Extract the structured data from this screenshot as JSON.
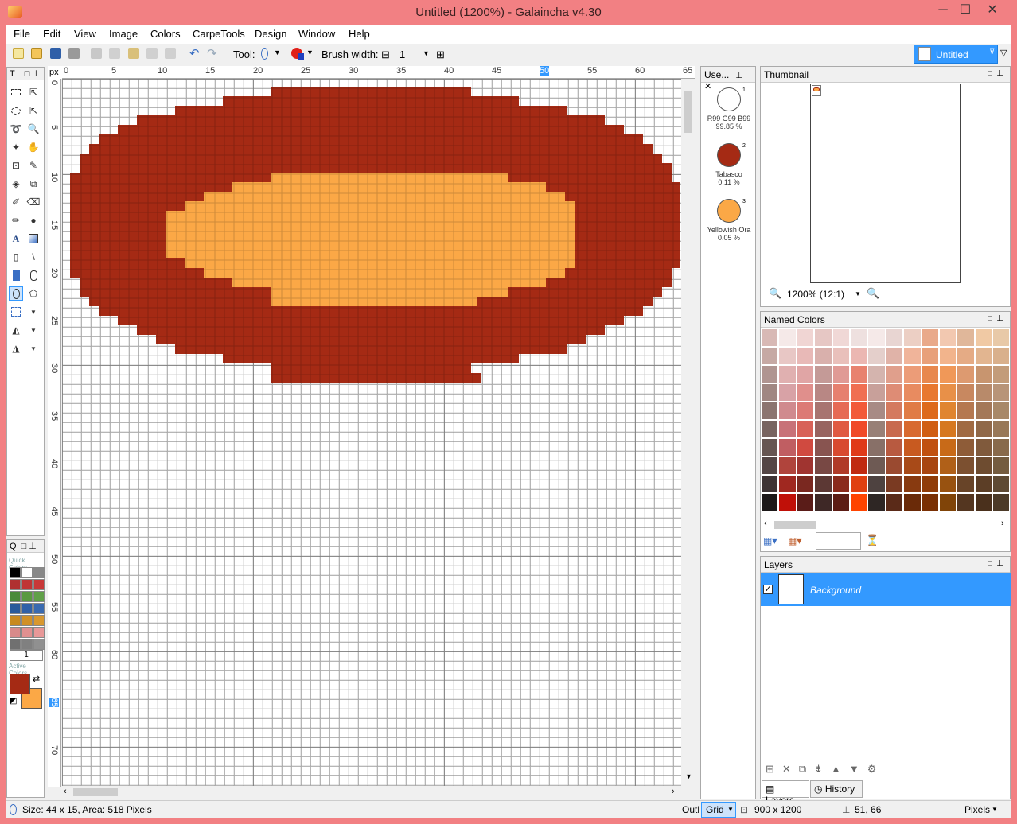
{
  "window": {
    "title": "Untitled (1200%) - Galaincha v4.30",
    "minimize": "─",
    "maximize": "☐",
    "close": "✕"
  },
  "menu": [
    "File",
    "Edit",
    "View",
    "Image",
    "Colors",
    "CarpeTools",
    "Design",
    "Window",
    "Help"
  ],
  "toolbar": {
    "tool_label": "Tool:",
    "brush_label": "Brush width:",
    "brush_minus": "⊟",
    "brush_value": "1",
    "brush_plus": "⊞"
  },
  "doc_tab": {
    "label": "Untitled"
  },
  "ruler": {
    "unit": "px",
    "top_ticks": [
      "0",
      "5",
      "10",
      "15",
      "20",
      "25",
      "30",
      "35",
      "40",
      "45",
      "50",
      "55",
      "60",
      "65"
    ],
    "left_ticks": [
      "0",
      "5",
      "10",
      "15",
      "20",
      "25",
      "30",
      "35",
      "40",
      "45",
      "50",
      "55",
      "60",
      "65",
      "70"
    ]
  },
  "toolbox": {
    "header": "T"
  },
  "quick": {
    "header": "Q",
    "quick_colors_label": "Quick Colors",
    "brush_size": "1",
    "active_colors_label": "Active Colors",
    "primary": "#a52a14",
    "secondary": "#fba846"
  },
  "used_colors": {
    "title": "Use...",
    "items": [
      {
        "num": "1",
        "name": "R99 G99 B99",
        "pct": "99.85 %",
        "color": "#ffffff"
      },
      {
        "num": "2",
        "name": "Tabasco",
        "pct": "0.11 %",
        "color": "#a52a14"
      },
      {
        "num": "3",
        "name": "Yellowish Ora",
        "pct": "0.05 %",
        "color": "#fba846"
      }
    ]
  },
  "thumbnail": {
    "title": "Thumbnail",
    "zoom": "1200% (12:1)"
  },
  "named_colors": {
    "title": "Named Colors"
  },
  "layers": {
    "title": "Layers",
    "items": [
      {
        "name": "Background",
        "visible": true
      }
    ],
    "tab_layers": "Layers",
    "tab_history": "History"
  },
  "status": {
    "selection": "Size: 44 x 15, Area: 518 Pixels",
    "outline": "Outl",
    "grid": "Grid",
    "canvas_size": "900 x 1200",
    "cursor": "51, 66",
    "units": "Pixels"
  },
  "colors": {
    "tabasco": "#a52a14",
    "orange": "#fba846",
    "accent": "#3399ff"
  }
}
